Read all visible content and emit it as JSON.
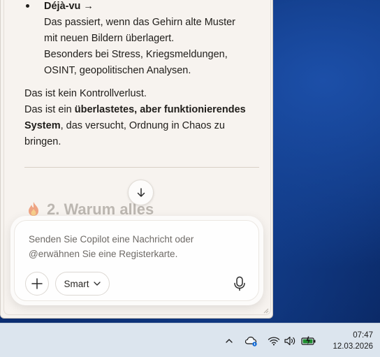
{
  "panel": {
    "bullet": {
      "title": "Déjà-vu",
      "arrow": "→",
      "lines": [
        "Das passiert, wenn das Gehirn alte Muster",
        "mit neuen Bildern überlagert.",
        "Besonders bei Stress, Kriegsmeldungen,",
        "OSINT, geopolitischen Analysen."
      ]
    },
    "paragraph": {
      "line1": "Das ist kein Kontrollverlust.",
      "line2_pre": "Das ist ein ",
      "line2_bold": "überlastetes, aber funktionierendes",
      "line3_bold": "System",
      "line3_post": ", das versucht, Ordnung in Chaos zu",
      "line4": "bringen."
    },
    "next_heading": "2. Warum alles",
    "next_heading_icon": "flame-icon"
  },
  "composer": {
    "placeholder_line1": "Senden Sie Copilot eine Nachricht oder",
    "placeholder_line2": "@erwähnen Sie eine Registerkarte.",
    "mode_label": "Smart",
    "icons": [
      "plus-icon",
      "chevron-down-icon",
      "microphone-icon",
      "arrow-down-icon"
    ]
  },
  "taskbar": {
    "time": "07:47",
    "date": "12.03.2026",
    "tray_icons": [
      "chevron-up-icon",
      "onedrive-icon",
      "wifi-icon",
      "speaker-icon",
      "battery-icon"
    ]
  },
  "colors": {
    "panel_bg": "#f7f3ef",
    "taskbar_bg": "#dce5ee",
    "wallpaper": "#0d3580",
    "battery_accent": "#1e8c2e"
  }
}
